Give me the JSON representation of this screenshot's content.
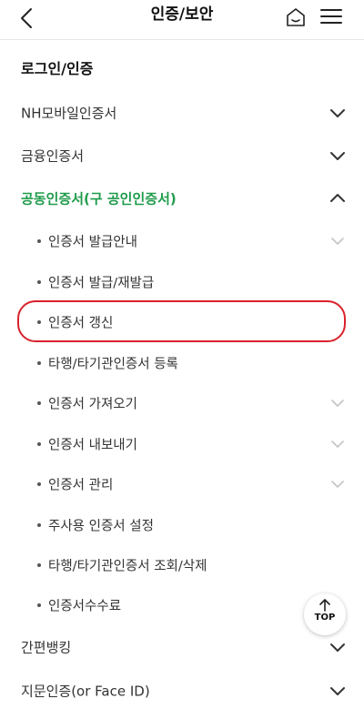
{
  "header": {
    "title": "인증/보안",
    "back_icon": "chevron-left-icon",
    "home_icon": "home-icon",
    "menu_icon": "hamburger-menu-icon"
  },
  "section": {
    "title": "로그인/인증"
  },
  "menu": {
    "nh_mobile": {
      "label": "NH모바일인증서",
      "state": "collapsed"
    },
    "financial_cert": {
      "label": "금융인증서",
      "state": "collapsed"
    },
    "joint_cert": {
      "label": "공동인증서(구 공인인증서)",
      "state": "expanded"
    },
    "simple_bank": {
      "label": "간편뱅킹",
      "state": "collapsed"
    },
    "biometric": {
      "label": "지문인증(or Face ID)",
      "state": "collapsed"
    }
  },
  "submenu": [
    {
      "label": "인증서 발급안내",
      "has_chevron": true
    },
    {
      "label": "인증서 발급/재발급",
      "has_chevron": false
    },
    {
      "label": "인증서 갱신",
      "has_chevron": false,
      "highlighted": true
    },
    {
      "label": "타행/타기관인증서 등록",
      "has_chevron": false
    },
    {
      "label": "인증서 가져오기",
      "has_chevron": true
    },
    {
      "label": "인증서 내보내기",
      "has_chevron": true
    },
    {
      "label": "인증서 관리",
      "has_chevron": true
    },
    {
      "label": "주사용 인증서 설정",
      "has_chevron": false
    },
    {
      "label": "타행/타기관인증서 조회/삭제",
      "has_chevron": false
    },
    {
      "label": "인증서수수료",
      "has_chevron": false
    }
  ],
  "top_button": {
    "label": "TOP"
  },
  "colors": {
    "accent_green": "#1e9b4a",
    "highlight_red": "#d9222b",
    "sub_chevron": "#c4c4c4",
    "main_chevron": "#333333"
  }
}
